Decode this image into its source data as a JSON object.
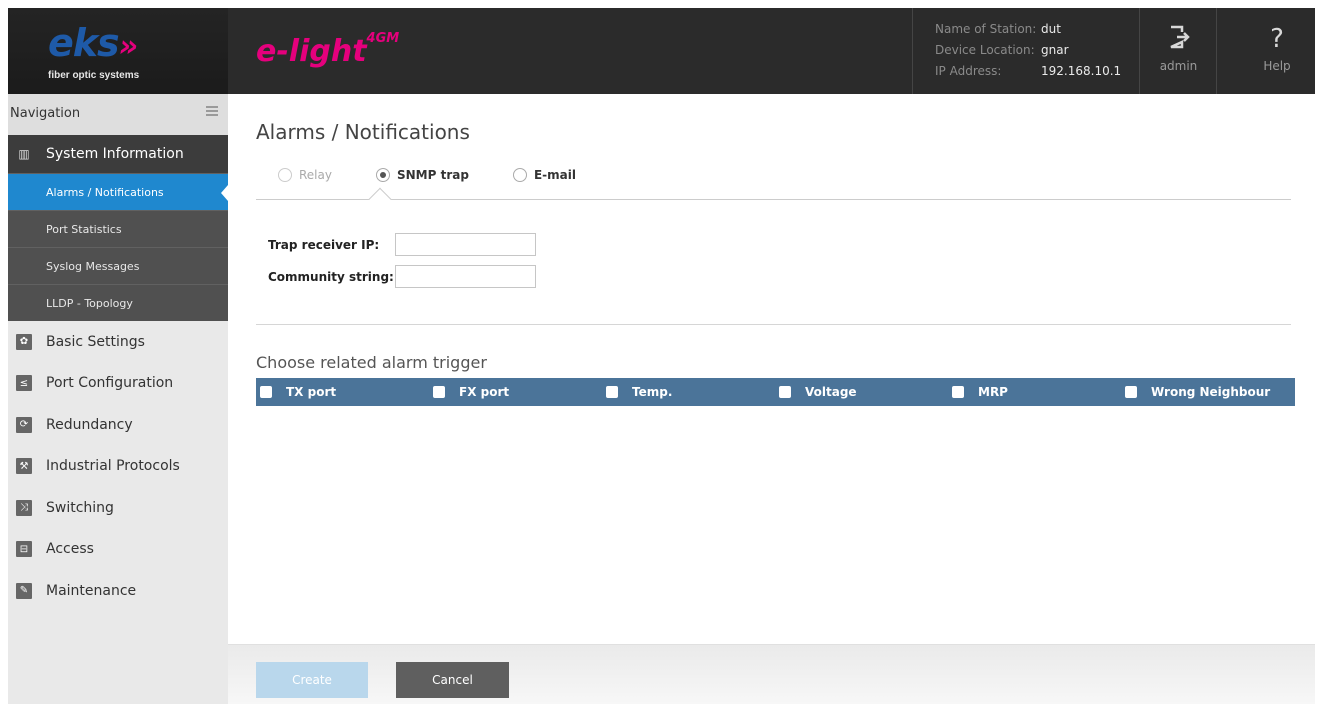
{
  "header": {
    "logo_text": "eks",
    "logo_arrows": "»",
    "logo_subtitle": "fiber optic systems",
    "product_name": "e-light",
    "product_suffix": "4GM",
    "station": [
      {
        "label": "Name of Station:",
        "value": "dut"
      },
      {
        "label": "Device Location:",
        "value": "gnar"
      },
      {
        "label": "IP Address:",
        "value": "192.168.10.1"
      }
    ],
    "user_label": "admin",
    "help_label": "Help",
    "colors": {
      "brand_blue": "#1e5aa8",
      "brand_magenta": "#e5007d"
    }
  },
  "sidebar": {
    "nav_label": "Navigation",
    "section": {
      "label": "System Information",
      "icon": "bar-chart-icon"
    },
    "subitems": [
      {
        "label": "Alarms / Notifications",
        "active": true
      },
      {
        "label": "Port Statistics"
      },
      {
        "label": "Syslog Messages"
      },
      {
        "label": "LLDP - Topology"
      }
    ],
    "items": [
      {
        "label": "Basic Settings",
        "icon": "gear-icon"
      },
      {
        "label": "Port Configuration",
        "icon": "port-config-icon"
      },
      {
        "label": "Redundancy",
        "icon": "redundancy-icon"
      },
      {
        "label": "Industrial Protocols",
        "icon": "industrial-icon"
      },
      {
        "label": "Switching",
        "icon": "switching-icon"
      },
      {
        "label": "Access",
        "icon": "lock-icon"
      },
      {
        "label": "Maintenance",
        "icon": "wrench-icon"
      }
    ],
    "colors": {
      "active": "#1f88cf"
    }
  },
  "main": {
    "title": "Alarms / Notifications",
    "tabs": [
      {
        "label": "Relay",
        "state": "disabled"
      },
      {
        "label": "SNMP trap",
        "state": "selected"
      },
      {
        "label": "E-mail",
        "state": "unselected"
      }
    ],
    "fields": {
      "trap_ip_label": "Trap receiver IP:",
      "trap_ip_value": "",
      "community_label": "Community string:",
      "community_value": ""
    },
    "trigger_title": "Choose related alarm trigger",
    "triggers": [
      "TX port",
      "FX port",
      "Temp.",
      "Voltage",
      "MRP",
      "Wrong Neighbour"
    ],
    "colors": {
      "trigger_bar": "#4b7499"
    }
  },
  "footer": {
    "create_label": "Create",
    "cancel_label": "Cancel"
  }
}
